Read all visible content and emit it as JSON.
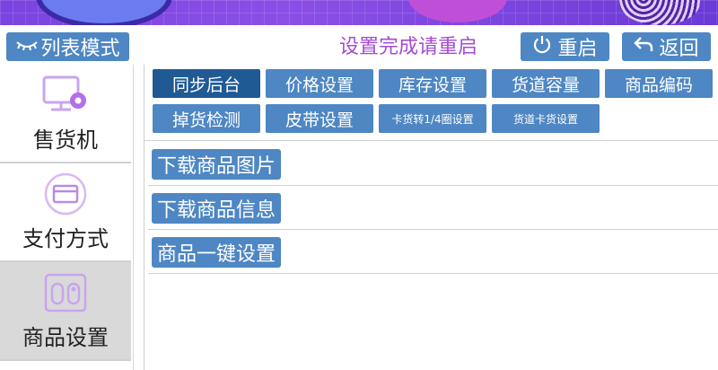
{
  "header": {
    "list_mode_label": "列表模式",
    "notice": "设置完成请重启",
    "restart_label": "重启",
    "back_label": "返回"
  },
  "sidebar": {
    "items": [
      {
        "label": "售货机",
        "icon": "monitor-gear-icon",
        "active": false
      },
      {
        "label": "支付方式",
        "icon": "card-icon",
        "active": false
      },
      {
        "label": "商品设置",
        "icon": "goods-settings-icon",
        "active": true
      }
    ]
  },
  "tabs": [
    {
      "label": "同步后台",
      "active": true
    },
    {
      "label": "价格设置"
    },
    {
      "label": "库存设置"
    },
    {
      "label": "货道容量"
    },
    {
      "label": "商品编码"
    },
    {
      "label": "掉货检测"
    },
    {
      "label": "皮带设置"
    },
    {
      "label": "卡货转1/4圈设置"
    },
    {
      "label": "货道卡货设置"
    }
  ],
  "rows": [
    {
      "label": "下载商品图片"
    },
    {
      "label": "下载商品信息"
    },
    {
      "label": "商品一键设置"
    }
  ],
  "colors": {
    "accent": "#4e87c3",
    "active_tab": "#1f5a95",
    "notice": "#a44bd2"
  }
}
